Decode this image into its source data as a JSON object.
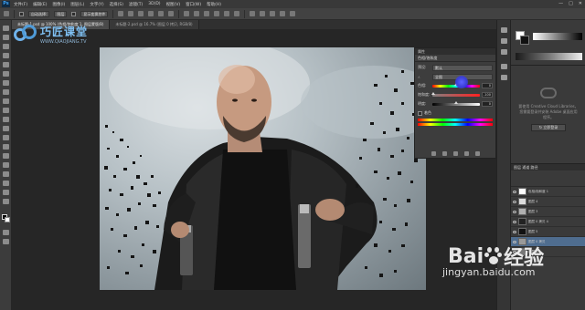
{
  "menubar": {
    "app_logo": "Ps",
    "items": [
      "文件(F)",
      "编辑(E)",
      "图像(I)",
      "图层(L)",
      "文字(Y)",
      "选择(S)",
      "滤镜(T)",
      "3D(D)",
      "视图(V)",
      "窗口(W)",
      "帮助(H)"
    ],
    "window_controls": [
      "—",
      "□",
      "✕"
    ]
  },
  "optionsbar": {
    "chips": [
      "自动选择:",
      "图层",
      "显示变换控件"
    ]
  },
  "tabs": [
    {
      "label": "未标题-1.psd @ 100% (色相/饱和度 1, 图层蒙版/8)",
      "active": true
    },
    {
      "label": "未标题-2.psd @ 16.7% (图层 0 拷贝, RGB/8)",
      "active": false
    }
  ],
  "watermark": {
    "brand": "巧匠课堂",
    "url": "WWW.QIAOJIANG.TV"
  },
  "properties_panel": {
    "header": "属性",
    "title": "色相/饱和度",
    "preset_label": "预设:",
    "preset_value": "默认",
    "channel_value": "全图",
    "rows": [
      {
        "label": "色相:",
        "value": "0",
        "pos": 0.5,
        "track": "hue"
      },
      {
        "label": "饱和度:",
        "value": "-100",
        "pos": 0.02,
        "track": "sat"
      },
      {
        "label": "明度:",
        "value": "0",
        "pos": 0.5,
        "track": "light"
      }
    ],
    "colorize_label": "着色"
  },
  "color_panel": {
    "fg": "#ffffff",
    "bg": "#111111"
  },
  "libraries_panel": {
    "message": "要使用 Creative Cloud Libraries，您需要登录并安装 Adobe 桌面应用程序。",
    "button": "↻ 立即登录"
  },
  "layers_panel": {
    "tabs": "图层  通道  路径",
    "layers": [
      {
        "name": "色相/饱和度 1",
        "selected": false,
        "thumb": "#ffffff"
      },
      {
        "name": "图层 4",
        "selected": false,
        "thumb": "#dcdcdc"
      },
      {
        "name": "图层 3",
        "selected": false,
        "thumb": "#b0b0b0"
      },
      {
        "name": "图层 0 拷贝 4",
        "selected": false,
        "thumb": "#222222"
      },
      {
        "name": "图层 5",
        "selected": false,
        "thumb": "#111111"
      },
      {
        "name": "图层 0 拷贝",
        "selected": true,
        "thumb": "#999999"
      },
      {
        "name": "图层 0",
        "selected": false,
        "thumb": "#777777"
      }
    ]
  },
  "baidu_watermark": {
    "brand": "Bai",
    "product": "经验",
    "url": "jingyan.baidu.com"
  },
  "colors": {
    "panel_bg": "#3a3a3a",
    "workspace_bg": "#262626",
    "accent_cursor": "#3b3fd8",
    "selection": "#4f6d8f"
  }
}
